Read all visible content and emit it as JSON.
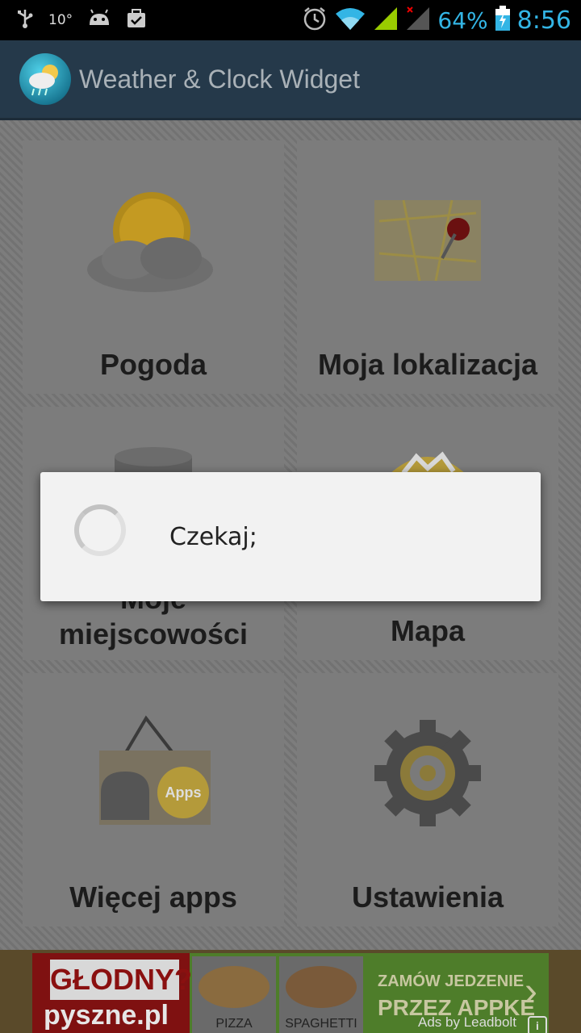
{
  "status_bar": {
    "temperature": "10°",
    "battery_percent": "64%",
    "time": "8:56",
    "icons": [
      "usb-icon",
      "android-icon",
      "task-icon",
      "alarm-icon",
      "wifi-icon",
      "signal-icon",
      "signal-no-data-icon",
      "battery-charging-icon"
    ],
    "accent_color": "#33b5e5"
  },
  "action_bar": {
    "title": "Weather & Clock Widget",
    "icon": "weather-app-icon"
  },
  "tiles": [
    {
      "label": "Pogoda",
      "icon": "sun-cloud-icon"
    },
    {
      "label": "Moja lokalizacja",
      "icon": "map-pin-icon"
    },
    {
      "label": "Moje miejscowości",
      "icon": "database-icon"
    },
    {
      "label": "Mapa",
      "icon": "globe-icon"
    },
    {
      "label": "Więcej apps",
      "icon": "android-apps-bag-icon"
    },
    {
      "label": "Ustawienia",
      "icon": "gear-icon"
    }
  ],
  "dialog": {
    "message": "Czekaj;",
    "icon": "spinner-icon"
  },
  "ad": {
    "headline": "GŁODNY?",
    "brand": "pyszne.pl",
    "food_1": "PIZZA",
    "food_2": "SPAGHETTI",
    "cta_line_1": "ZAMÓW JEDZENIE",
    "cta_line_2": "PRZEZ APPKE",
    "provider": "Ads by Leadbolt",
    "info_icon": "info-icon"
  }
}
